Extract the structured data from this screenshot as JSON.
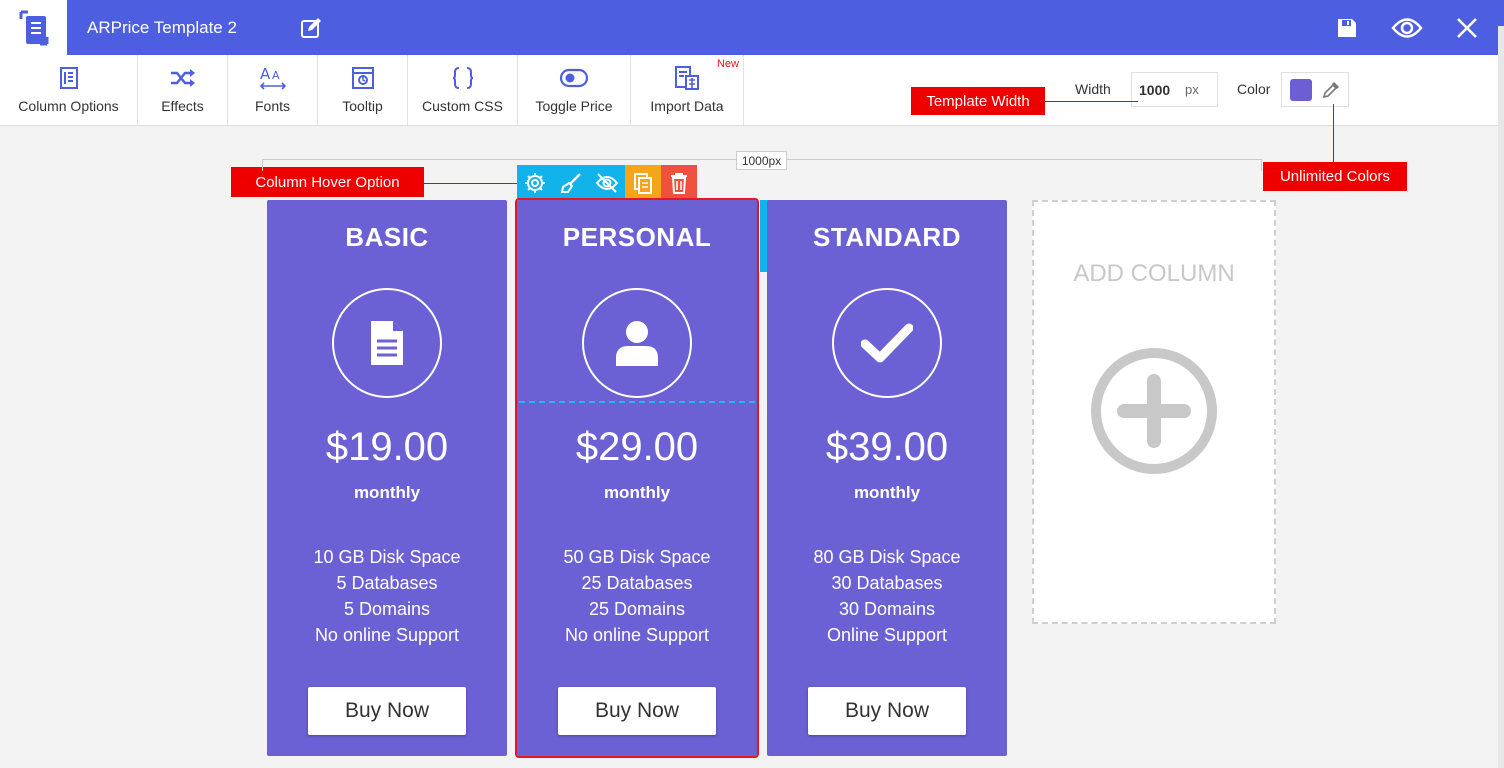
{
  "header": {
    "title": "ARPrice Template 2",
    "bg_color": "#4d5fe0",
    "icons": [
      "logo-icon",
      "edit-icon",
      "save-icon",
      "preview-icon",
      "close-icon"
    ]
  },
  "toolbar": {
    "items": [
      {
        "label": "Column Options",
        "icon": "column-options-icon"
      },
      {
        "label": "Effects",
        "icon": "shuffle-icon"
      },
      {
        "label": "Fonts",
        "icon": "fonts-icon"
      },
      {
        "label": "Tooltip",
        "icon": "tooltip-icon"
      },
      {
        "label": "Custom CSS",
        "icon": "braces-icon"
      },
      {
        "label": "Toggle Price",
        "icon": "toggle-icon"
      },
      {
        "label": "Import Data",
        "icon": "import-icon",
        "badge": "New"
      }
    ],
    "width_label": "Width",
    "width_value": "1000",
    "width_unit": "px",
    "color_label": "Color",
    "color_value": "#6b5fd3"
  },
  "callouts": {
    "template_width": "Template Width",
    "unlimited_colors": "Unlimited Colors",
    "column_hover": "Column Hover Option"
  },
  "ruler": {
    "label": "1000px"
  },
  "columns": [
    {
      "title": "BASIC",
      "icon": "document-icon",
      "price": "$19.00",
      "period": "monthly",
      "features": [
        "10 GB Disk Space",
        "5 Databases",
        "5 Domains",
        "No online Support"
      ],
      "button": "Buy Now"
    },
    {
      "title": "PERSONAL",
      "icon": "user-icon",
      "price": "$29.00",
      "period": "monthly",
      "features": [
        "50 GB Disk Space",
        "25 Databases",
        "25 Domains",
        "No online Support"
      ],
      "button": "Buy Now"
    },
    {
      "title": "STANDARD",
      "icon": "check-icon",
      "price": "$39.00",
      "period": "monthly",
      "features": [
        "80 GB Disk Space",
        "30 Databases",
        "30 Domains",
        "Online Support"
      ],
      "button": "Buy Now"
    }
  ],
  "add_column": {
    "label": "ADD COLUMN"
  },
  "colors": {
    "column_bg": "#6c61d4",
    "accent_blue": "#12b3eb",
    "callout_red": "#ee0000"
  }
}
